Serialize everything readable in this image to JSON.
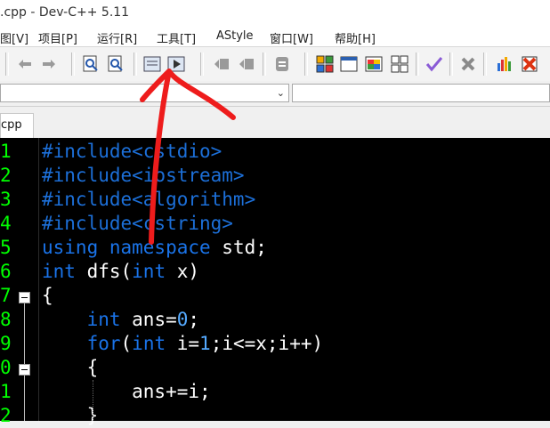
{
  "window": {
    "title": ".cpp - Dev-C++ 5.11"
  },
  "menu": [
    {
      "key": "view_partial",
      "label": "图[V]"
    },
    {
      "key": "project",
      "label": "项目[P]"
    },
    {
      "key": "run",
      "label": "运行[R]"
    },
    {
      "key": "tools",
      "label": "工具[T]"
    },
    {
      "key": "astyle",
      "label": "AStyle"
    },
    {
      "key": "window",
      "label": "窗口[W]"
    },
    {
      "key": "help",
      "label": "帮助[H]"
    }
  ],
  "toolbar_icons": [
    "undo-icon",
    "redo-icon",
    "find-icon",
    "replace-icon",
    "compile-icon",
    "run-icon",
    "indent-icon",
    "unindent-icon",
    "toggle-comment-icon",
    "new-class-icon",
    "window-icon",
    "color-icon",
    "grid-icon",
    "check-icon",
    "delete-icon",
    "chart-icon",
    "debug-icon"
  ],
  "tab": {
    "label": "cpp"
  },
  "editor": {
    "line_numbers": [
      "1",
      "2",
      "3",
      "4",
      "5",
      "6",
      "7",
      "8",
      "9",
      "0",
      "1",
      "2"
    ],
    "lines": [
      [
        {
          "t": "pre",
          "s": "#include<cstdio>"
        }
      ],
      [
        {
          "t": "pre",
          "s": "#include<iostream>"
        }
      ],
      [
        {
          "t": "pre",
          "s": "#include<algorithm>"
        }
      ],
      [
        {
          "t": "pre",
          "s": "#include<cstring>"
        }
      ],
      [
        {
          "t": "kw",
          "s": "using namespace "
        },
        {
          "t": "wh",
          "s": "std;"
        }
      ],
      [
        {
          "t": "kw",
          "s": "int "
        },
        {
          "t": "wh",
          "s": "dfs("
        },
        {
          "t": "kw",
          "s": "int "
        },
        {
          "t": "wh",
          "s": "x)"
        }
      ],
      [
        {
          "t": "wh",
          "s": "{"
        }
      ],
      [
        {
          "t": "wh",
          "s": "    "
        },
        {
          "t": "kw",
          "s": "int "
        },
        {
          "t": "wh",
          "s": "ans="
        },
        {
          "t": "num",
          "s": "0"
        },
        {
          "t": "wh",
          "s": ";"
        }
      ],
      [
        {
          "t": "wh",
          "s": "    "
        },
        {
          "t": "kw",
          "s": "for"
        },
        {
          "t": "wh",
          "s": "("
        },
        {
          "t": "kw",
          "s": "int "
        },
        {
          "t": "wh",
          "s": "i="
        },
        {
          "t": "num",
          "s": "1"
        },
        {
          "t": "wh",
          "s": ";i<=x;i++)"
        }
      ],
      [
        {
          "t": "wh",
          "s": "    {"
        }
      ],
      [
        {
          "t": "wh",
          "s": "        ans+=i;"
        }
      ],
      [
        {
          "t": "wh",
          "s": "    }"
        }
      ]
    ]
  },
  "colors": {
    "line_number": "#00ff00",
    "keyword": "#1a73e8",
    "preprocessor": "#1c6fd8",
    "annotation_arrow": "#ee1c1c"
  }
}
